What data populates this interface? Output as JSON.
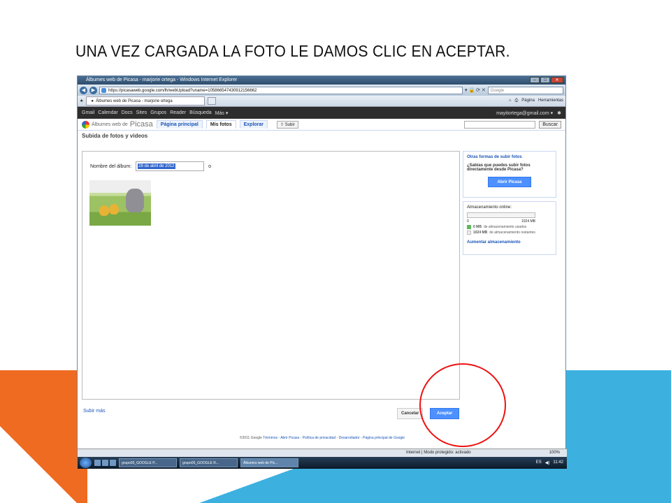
{
  "slide": {
    "title": "UNA VEZ CARGADA LA FOTO LE DAMOS CLIC EN ACEPTAR.",
    "colors": {
      "orange": "#ef6b21",
      "blue": "#3cb1e0",
      "annotation": "#e11111"
    }
  },
  "browser": {
    "window_title": "Álbumes web de Picasa - marjorie ortega - Windows Internet Explorer",
    "address": "https://picasaweb.google.com/lh/webUpload?uname=105866547430912156662",
    "search_placeholder": "Google",
    "tab_title": "Álbumes web de Picasa - marjorie ortega",
    "commands": {
      "pagina": "Página",
      "herramientas": "Herramientas"
    }
  },
  "google_bar": {
    "links": [
      "Gmail",
      "Calendar",
      "Docs",
      "Sites",
      "Grupos",
      "Reader",
      "Búsqueda",
      "Más ▾"
    ],
    "user": "mayitortega@gmail.com ▾"
  },
  "picasa": {
    "logo_small": "Álbumes web de",
    "logo_big": "Picasa",
    "tabs": [
      "Página principal",
      "Mis fotos",
      "Explorar"
    ],
    "upload_button": "Subir",
    "search_button": "Buscar",
    "section_title": "Subida de fotos y videos",
    "album_label": "Nombre del álbum:",
    "album_value": "28 de abril de 2012",
    "album_suffix": "o",
    "more_link": "Subir más",
    "cancel_button": "Cancelar",
    "accept_button": "Aceptar"
  },
  "sidebar": {
    "other_ways_title": "Otras formas de subir fotos",
    "other_ways_text": "¿Sabías que puedes subir fotos directamente desde Picasa?",
    "open_picasa": "Abrir Picasa",
    "storage_title": "Almacenamiento online:",
    "storage_min": "0",
    "storage_max": "1024 MB",
    "storage_used_fraction": 0,
    "used_value": "0 MB",
    "used_label": "de almacenamiento usados",
    "remaining_value": "1024 MB",
    "remaining_label": "de almacenamiento restantes",
    "increase_link": "Aumentar almacenamiento"
  },
  "footer": {
    "copyright": "©2011 Google",
    "links": [
      "Términos",
      "Abrir Picasa",
      "Política de privacidad",
      "Desarrollador",
      "Página principal de Google"
    ]
  },
  "status_bar": {
    "mode": "Internet | Modo protegido: activado",
    "zoom": "100%"
  },
  "taskbar": {
    "tasks": [
      "grupo05_GOOGLE P...",
      "grupo05_GOOGLE R...",
      "Álbumes web de Pic..."
    ],
    "lang": "ES",
    "time": "11:42"
  }
}
